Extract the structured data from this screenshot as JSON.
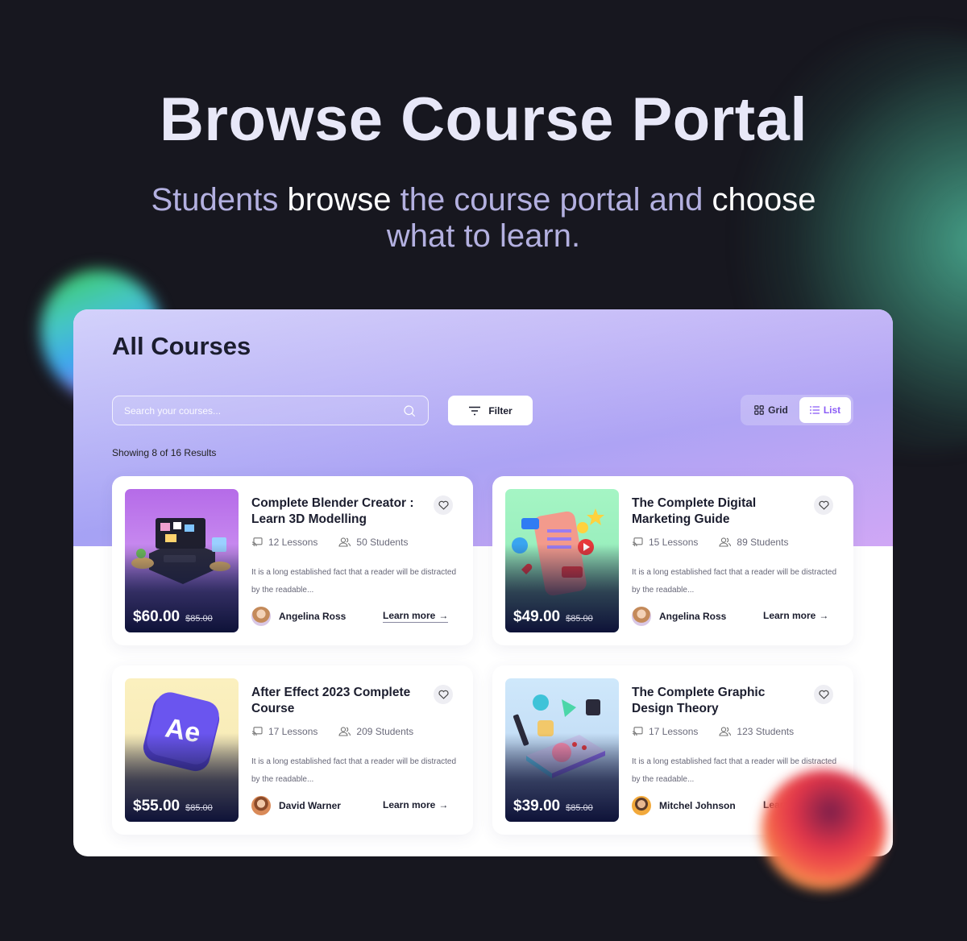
{
  "hero": {
    "title": "Browse Course Portal",
    "subtitle_parts": [
      {
        "text": "Students ",
        "highlight": false
      },
      {
        "text": "browse",
        "highlight": true
      },
      {
        "text": " the course portal and ",
        "highlight": false
      },
      {
        "text": "choose",
        "highlight": true
      },
      {
        "text": " what to learn.",
        "highlight": false
      }
    ]
  },
  "panel": {
    "title": "All Courses",
    "search": {
      "placeholder": "Search your courses...",
      "value": "",
      "icon": "search-icon"
    },
    "filter_label": "Filter",
    "view_toggle": {
      "grid_label": "Grid",
      "list_label": "List",
      "active": "List"
    },
    "results_text": "Showing 8 of 16 Results"
  },
  "colors": {
    "background": "#17171f",
    "accent": "#8b5cf6",
    "title_text": "#1b1d2e",
    "subtitle_text": "#b3b0e0"
  },
  "courses": [
    {
      "title": "Complete Blender Creator : Learn 3D Modelling",
      "lessons": "12 Lessons",
      "students": "50 Students",
      "description": "It is a long established fact that a reader will be distracted by the readable...",
      "price": "$60.00",
      "old_price": "$85.00",
      "author": "Angelina Ross",
      "cta": "Learn more",
      "image_theme": "purple"
    },
    {
      "title": "The Complete Digital Marketing Guide",
      "lessons": "15 Lessons",
      "students": "89 Students",
      "description": "It is a long established fact that a reader will be distracted by the readable...",
      "price": "$49.00",
      "old_price": "$85.00",
      "author": "Angelina Ross",
      "cta": "Learn more",
      "image_theme": "green"
    },
    {
      "title": "After Effect 2023 Complete Course",
      "lessons": "17 Lessons",
      "students": "209 Students",
      "description": "It is a long established fact that a reader will be distracted by the readable...",
      "price": "$55.00",
      "old_price": "$85.00",
      "author": "David Warner",
      "cta": "Learn more",
      "image_theme": "yellow",
      "badge_text": "Ae"
    },
    {
      "title": "The Complete Graphic Design Theory",
      "lessons": "17 Lessons",
      "students": "123 Students",
      "description": "It is a long established fact that a reader will be distracted by the readable...",
      "price": "$39.00",
      "old_price": "$85.00",
      "author": "Mitchel Johnson",
      "cta": "Learn more",
      "image_theme": "blue"
    }
  ]
}
